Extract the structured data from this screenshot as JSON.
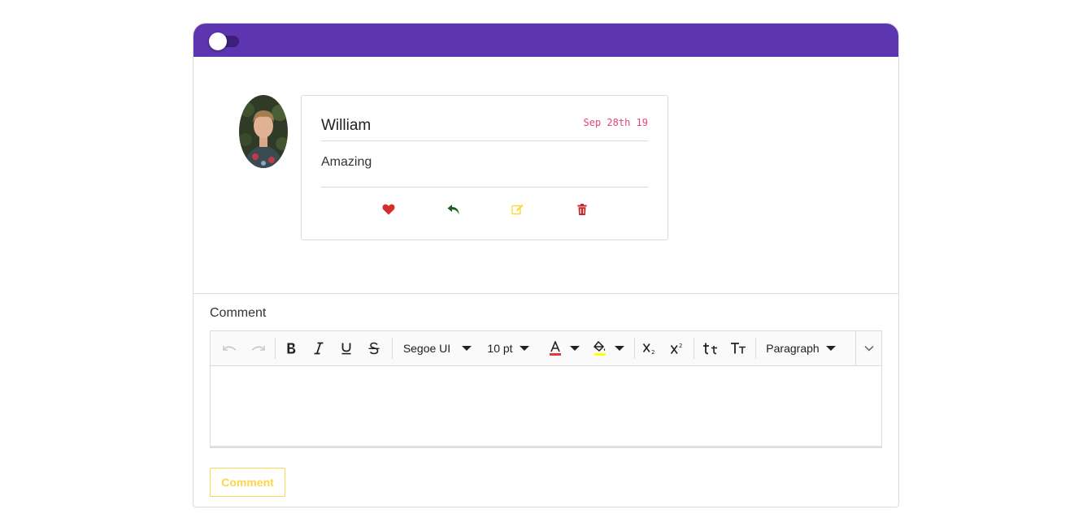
{
  "header": {
    "toggle_state": "off",
    "color": "#5e35b1"
  },
  "comment": {
    "author": "William",
    "date": "Sep 28th 19",
    "text": "Amazing",
    "actions": [
      "heart-icon",
      "reply-icon",
      "edit-icon",
      "trash-icon"
    ]
  },
  "editor": {
    "label": "Comment",
    "font_family": "Segoe UI",
    "font_size": "10 pt",
    "format": "Paragraph",
    "body_value": ""
  },
  "submit": {
    "label": "Comment"
  },
  "colors": {
    "accent": "#5e35b1",
    "heart": "#d32f2f",
    "reply": "#1b5e20",
    "edit": "#fdd835",
    "delete": "#c62828",
    "date": "#e0457b",
    "button": "#ffd54f"
  }
}
